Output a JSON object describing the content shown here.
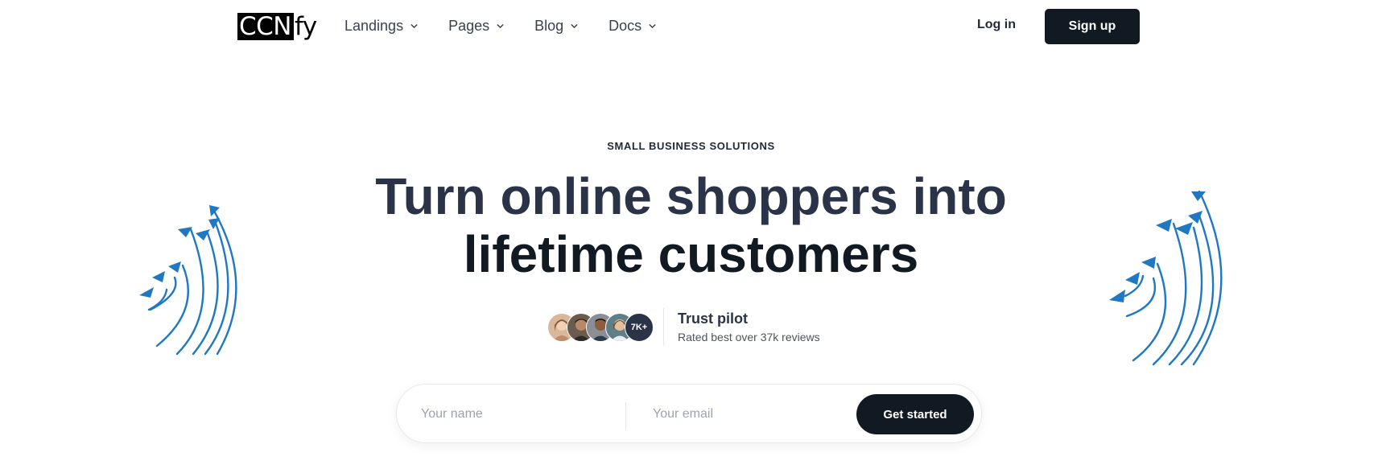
{
  "header": {
    "logo": {
      "boxed": "CCN",
      "rest": "fy"
    },
    "nav": [
      {
        "label": "Landings"
      },
      {
        "label": "Pages"
      },
      {
        "label": "Blog"
      },
      {
        "label": "Docs"
      }
    ],
    "login_label": "Log in",
    "signup_label": "Sign up"
  },
  "hero": {
    "eyebrow": "SMALL BUSINESS SOLUTIONS",
    "headline_line1": "Turn online shoppers into",
    "headline_line2": "lifetime customers"
  },
  "trust": {
    "count_badge": "7K+",
    "title": "Trust pilot",
    "subtitle": "Rated best over 37k reviews"
  },
  "form": {
    "name_placeholder": "Your name",
    "email_placeholder": "Your email",
    "submit_label": "Get started"
  },
  "colors": {
    "primary_dark": "#111a22",
    "heading": "#2a3347",
    "decor_blue": "#1f78c1",
    "muted_text": "#9ca3af"
  },
  "icons": {
    "nav_chevron": "chevron-down-icon",
    "decor_left": "arrows-decoration-icon",
    "decor_right": "arrows-decoration-icon"
  }
}
